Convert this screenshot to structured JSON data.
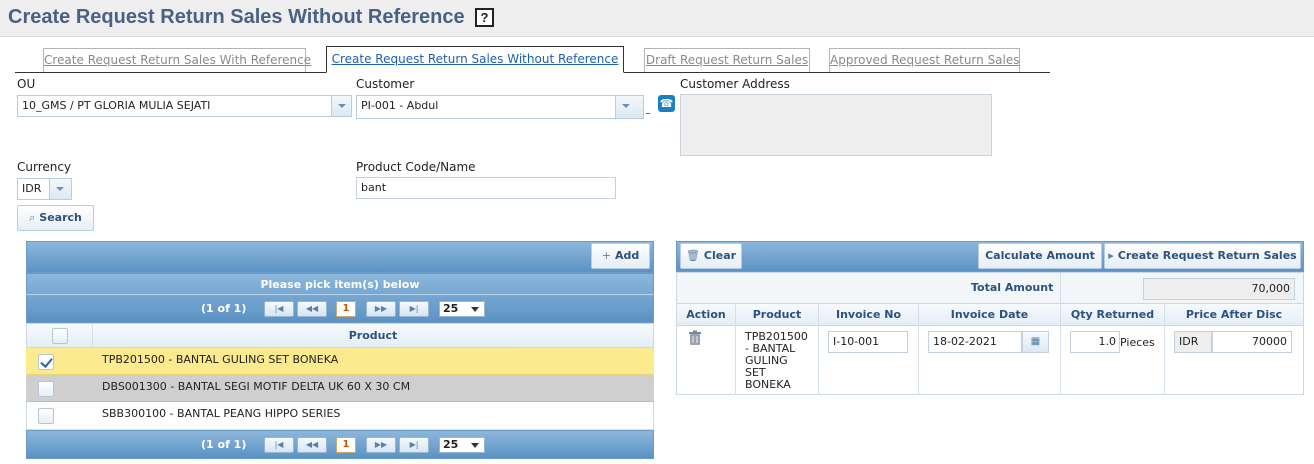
{
  "header": {
    "title": "Create Request Return Sales Without Reference",
    "help": "?"
  },
  "tabs": [
    {
      "label": "Create Request Return Sales With Reference"
    },
    {
      "label": "Create Request Return Sales Without Reference"
    },
    {
      "label": "Draft Request Return Sales"
    },
    {
      "label": "Approved Request Return Sales"
    }
  ],
  "form": {
    "ou_label": "OU",
    "ou_value": "10_GMS / PT GLORIA MULIA SEJATI",
    "customer_label": "Customer",
    "customer_value": "PI-001 - Abdul",
    "address_label": "Customer Address",
    "currency_label": "Currency",
    "currency_value": "IDR",
    "product_label": "Product Code/Name",
    "product_value": "bant",
    "search_label": "Search"
  },
  "left_panel": {
    "add_label": "Add",
    "title": "Please pick item(s) below",
    "pager_text": "(1 of 1)",
    "page_number": "1",
    "page_size": "25",
    "column_header": "Product",
    "rows": [
      {
        "text": "TPB201500 - BANTAL GULING SET BONEKA",
        "checked": true
      },
      {
        "text": "DBS001300 - BANTAL SEGI MOTIF DELTA UK 60 X 30 CM",
        "checked": false
      },
      {
        "text": "SBB300100 - BANTAL PEANG HIPPO SERIES",
        "checked": false
      }
    ]
  },
  "right_panel": {
    "clear_label": "Clear",
    "calculate_label": "Calculate Amount",
    "create_label": "Create Request Return Sales",
    "total_label": "Total Amount",
    "total_value": "70,000",
    "columns": [
      "Action",
      "Product",
      "Invoice No",
      "Invoice Date",
      "Qty Returned",
      "Price After Disc"
    ],
    "row": {
      "product_lines": [
        "TPB201500",
        "- BANTAL",
        "GULING",
        "SET",
        "BONEKA"
      ],
      "invoice_no": "I-10-001",
      "invoice_date": "18-02-2021",
      "qty": "1.0",
      "unit": "Pieces",
      "currency": "IDR",
      "price": "70000"
    }
  }
}
